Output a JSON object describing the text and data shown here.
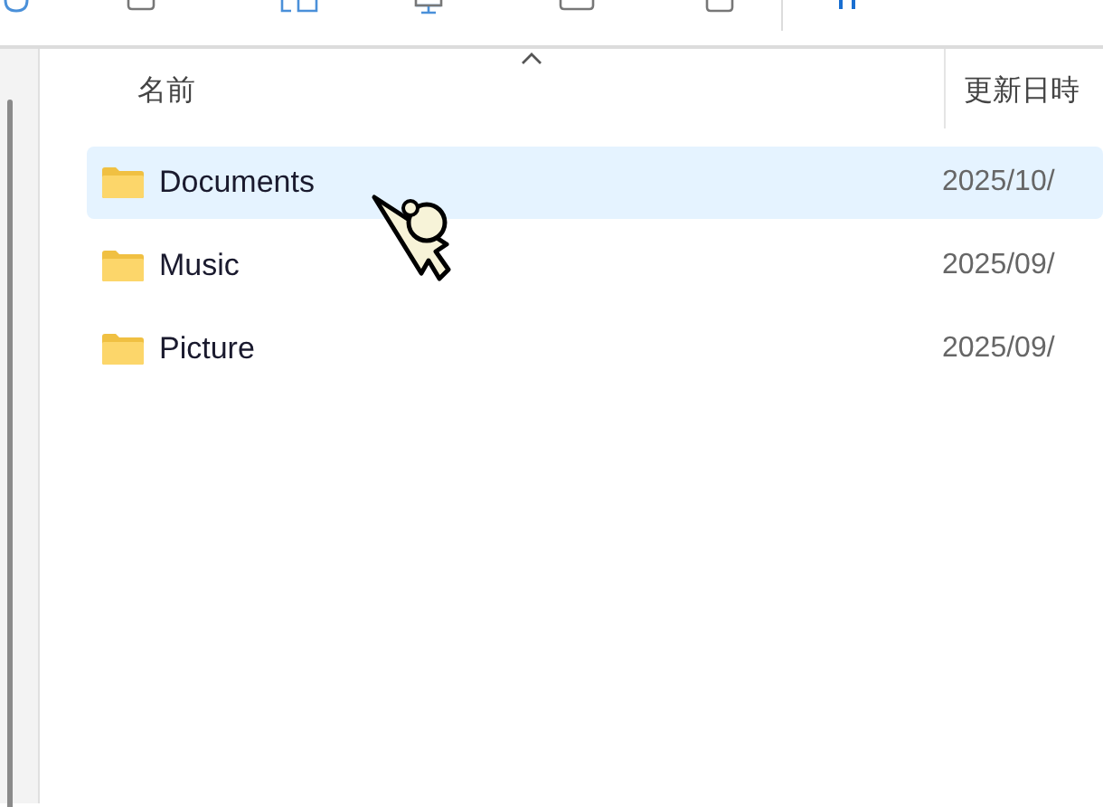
{
  "columns": [
    {
      "label": "名前",
      "sorted": true
    },
    {
      "label": "更新日時",
      "sorted": false
    }
  ],
  "rows": [
    {
      "name": "Documents",
      "date": "2025/10/",
      "selected": true
    },
    {
      "name": "Music",
      "date": "2025/09/",
      "selected": false
    },
    {
      "name": "Picture",
      "date": "2025/09/",
      "selected": false
    }
  ]
}
